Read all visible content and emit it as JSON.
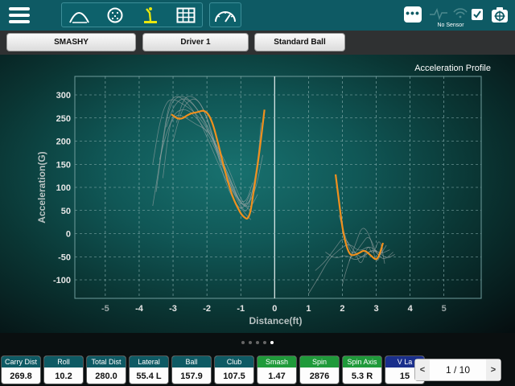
{
  "toolbar": {
    "view_icons": [
      "swing-arc-icon",
      "ball-icon",
      "golfer-icon",
      "table-grid-icon"
    ],
    "gauge_icon": "speedometer-icon",
    "more_label": "•••",
    "sensor_status": "No Sensor"
  },
  "selectors": {
    "mode": "SMASHY",
    "club": "Driver 1",
    "ball": "Standard Ball"
  },
  "chart_title": "Acceleration Profile",
  "chart_data": {
    "type": "line",
    "title": "Acceleration Profile",
    "xlabel": "Distance(ft)",
    "ylabel": "Acceleration(G)",
    "xlim": [
      -5,
      5
    ],
    "ylim": [
      -100,
      300
    ],
    "x_ticks": [
      -5,
      -4,
      -3,
      -2,
      -1,
      0,
      1,
      2,
      3,
      4,
      5
    ],
    "y_ticks": [
      300,
      250,
      200,
      150,
      100,
      50,
      0,
      -50,
      -100
    ],
    "grid": true,
    "highlight_color": "#f0901e",
    "trace_color": "#9aa5a5",
    "series": [
      {
        "x": [
          -3.05,
          -2.8,
          -2.5,
          -2.3,
          -2.05,
          -1.85,
          -1.65,
          -1.45,
          -1.25,
          -1.05,
          -0.95,
          -0.75,
          -0.6,
          -0.45,
          -0.3
        ],
        "y": [
          258,
          245,
          260,
          262,
          268,
          245,
          190,
          130,
          80,
          50,
          38,
          28,
          100,
          175,
          268
        ]
      },
      {
        "x": [
          1.8,
          1.9,
          2.0,
          2.1,
          2.2,
          2.3,
          2.5,
          2.65,
          2.85,
          3.0,
          3.1,
          3.2
        ],
        "y": [
          128,
          70,
          12,
          -22,
          -43,
          -48,
          -42,
          -35,
          -48,
          -58,
          -45,
          -20
        ]
      }
    ],
    "background_traces": [
      {
        "x": [
          -3.6,
          -3.4,
          -3.2,
          -3.0,
          -2.7,
          -2.4,
          -2.1,
          -1.8,
          -1.5,
          -1.2,
          -0.95,
          -0.6,
          -0.35
        ],
        "y": [
          150,
          240,
          285,
          292,
          280,
          265,
          240,
          200,
          150,
          100,
          55,
          80,
          170
        ]
      },
      {
        "x": [
          -3.5,
          -3.3,
          -3.1,
          -2.8,
          -2.5,
          -2.2,
          -1.9,
          -1.6,
          -1.3,
          -1.0,
          -0.8,
          -0.55
        ],
        "y": [
          90,
          200,
          280,
          300,
          290,
          260,
          215,
          160,
          110,
          65,
          55,
          120
        ]
      },
      {
        "x": [
          -3.2,
          -3.0,
          -2.7,
          -2.4,
          -2.1,
          -1.8,
          -1.5,
          -1.2,
          -1.0,
          -0.8,
          -0.5,
          -0.4
        ],
        "y": [
          230,
          275,
          296,
          280,
          250,
          205,
          150,
          95,
          60,
          40,
          150,
          240
        ]
      },
      {
        "x": [
          -3.3,
          -3.1,
          -2.9,
          -2.6,
          -2.3,
          -2.0,
          -1.7,
          -1.4,
          -1.1,
          -0.9,
          -0.7
        ],
        "y": [
          120,
          240,
          265,
          270,
          250,
          220,
          175,
          120,
          70,
          45,
          30
        ]
      },
      {
        "x": [
          -3.0,
          -2.8,
          -2.6,
          -2.3,
          -2.0,
          -1.7,
          -1.4,
          -1.1,
          -0.85,
          -0.65
        ],
        "y": [
          200,
          255,
          285,
          295,
          255,
          180,
          120,
          75,
          65,
          110
        ]
      },
      {
        "x": [
          -3.4,
          -3.15,
          -2.9,
          -2.6,
          -2.3,
          -2.0,
          -1.7,
          -1.35,
          -1.05,
          -0.75,
          -0.5
        ],
        "y": [
          160,
          230,
          260,
          250,
          235,
          225,
          190,
          140,
          80,
          50,
          85
        ]
      },
      {
        "x": [
          -3.6,
          -3.4,
          -3.25,
          -3.1,
          -2.9,
          -2.6,
          -2.3,
          -2.0,
          -1.6,
          -1.25,
          -0.9,
          -0.6
        ],
        "y": [
          60,
          150,
          230,
          285,
          300,
          285,
          255,
          210,
          140,
          90,
          60,
          45
        ]
      },
      {
        "x": [
          -2.9,
          -2.7,
          -2.5,
          -2.2,
          -1.95,
          -1.7,
          -1.45,
          -1.2,
          -0.95,
          -0.7
        ],
        "y": [
          240,
          290,
          300,
          285,
          240,
          175,
          110,
          70,
          48,
          90
        ]
      },
      {
        "x": [
          1.0,
          1.3,
          1.6,
          1.9,
          2.2,
          2.5,
          2.8,
          3.1,
          3.4
        ],
        "y": [
          -130,
          -95,
          -55,
          -35,
          -20,
          -40,
          -25,
          -45,
          -35
        ]
      },
      {
        "x": [
          1.2,
          1.5,
          1.8,
          2.05,
          2.35,
          2.6,
          2.9,
          3.2,
          3.5
        ],
        "y": [
          -80,
          -60,
          -30,
          -5,
          -40,
          -55,
          -30,
          -60,
          -40
        ]
      },
      {
        "x": [
          1.9,
          2.1,
          2.3,
          2.55,
          2.8,
          3.05,
          3.3
        ],
        "y": [
          40,
          -10,
          -50,
          -25,
          0,
          -55,
          -25
        ]
      },
      {
        "x": [
          2.0,
          2.15,
          2.4,
          2.6,
          2.85,
          3.0,
          3.2
        ],
        "y": [
          -110,
          -70,
          -20,
          20,
          -10,
          -70,
          -30
        ]
      },
      {
        "x": [
          1.5,
          1.8,
          2.1,
          2.4,
          2.75,
          3.0,
          3.3,
          3.55
        ],
        "y": [
          -40,
          -55,
          -45,
          -60,
          -40,
          -35,
          -55,
          -45
        ]
      },
      {
        "x": [
          2.2,
          2.35,
          2.55,
          2.75,
          2.9,
          3.1,
          3.25
        ],
        "y": [
          -60,
          -30,
          -75,
          -20,
          -50,
          -5,
          -65
        ]
      }
    ]
  },
  "page_dots": {
    "count": 5,
    "active": 4
  },
  "stats": [
    {
      "label": "Carry Dist",
      "value": "269.8",
      "color": "#0e5a64"
    },
    {
      "label": "Roll",
      "value": "10.2",
      "color": "#0e5a64"
    },
    {
      "label": "Total Dist",
      "value": "280.0",
      "color": "#0e5a64"
    },
    {
      "label": "Lateral",
      "value": "55.4 L",
      "color": "#0e5a64"
    },
    {
      "label": "Ball",
      "value": "157.9",
      "color": "#0e5a64"
    },
    {
      "label": "Club",
      "value": "107.5",
      "color": "#0e5a64"
    },
    {
      "label": "Smash",
      "value": "1.47",
      "color": "#1f9a3a"
    },
    {
      "label": "Spin",
      "value": "2876",
      "color": "#1f9a3a"
    },
    {
      "label": "Spin Axis",
      "value": "5.3 R",
      "color": "#1f9a3a"
    },
    {
      "label": "V La",
      "value": "15",
      "color": "#1a2f8c"
    }
  ],
  "pager": {
    "prev": "<",
    "next": ">",
    "text": "1 / 10"
  }
}
